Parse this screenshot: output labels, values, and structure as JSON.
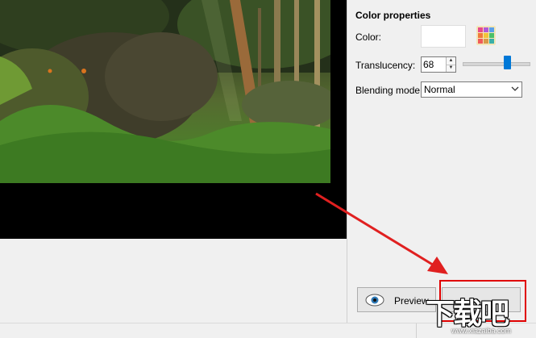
{
  "properties_panel": {
    "title": "Color properties",
    "color_label": "Color:",
    "color_value": "#ffffff",
    "translucency_label": "Translucency:",
    "translucency_value": "68",
    "translucency_level": 0.68,
    "blending_label": "Blending mode:",
    "blending_value": "Normal"
  },
  "buttons": {
    "preview_label": "Preview",
    "ok_label": ""
  },
  "icons": {
    "palette": "color-palette-icon",
    "eye": "eye-icon",
    "spin_up": "spin-up-icon",
    "spin_down": "spin-down-icon",
    "dropdown": "chevron-down-icon"
  },
  "annotation": {
    "arrow_color": "#e02020",
    "highlight_color": "#e00000"
  },
  "watermark": {
    "logo_text": "下载吧",
    "url": "www.xiazaiba.com"
  }
}
